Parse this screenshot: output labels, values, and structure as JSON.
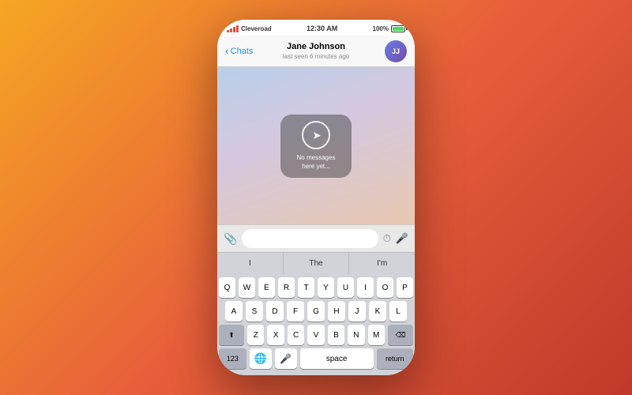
{
  "statusBar": {
    "carrier": "Cleveroad",
    "time": "12:30 AM",
    "battery": "100%"
  },
  "navBar": {
    "backLabel": "Chats",
    "contactName": "Jane Johnson",
    "lastSeen": "last seen 6 minutes ago"
  },
  "chatArea": {
    "emptyStateText": "No messages\nhere yet..."
  },
  "inputBar": {
    "placeholder": ""
  },
  "wordSuggestions": {
    "words": [
      "I",
      "The",
      "I'm"
    ]
  },
  "keyboard": {
    "row1": [
      "Q",
      "W",
      "E",
      "R",
      "T",
      "Y",
      "U",
      "I",
      "O",
      "P"
    ],
    "row2": [
      "A",
      "S",
      "D",
      "F",
      "G",
      "H",
      "J",
      "K",
      "L"
    ],
    "row3": [
      "Z",
      "X",
      "C",
      "V",
      "B",
      "N",
      "M"
    ],
    "bottomRow": {
      "numbers": "123",
      "space": "space",
      "return": "return"
    }
  }
}
